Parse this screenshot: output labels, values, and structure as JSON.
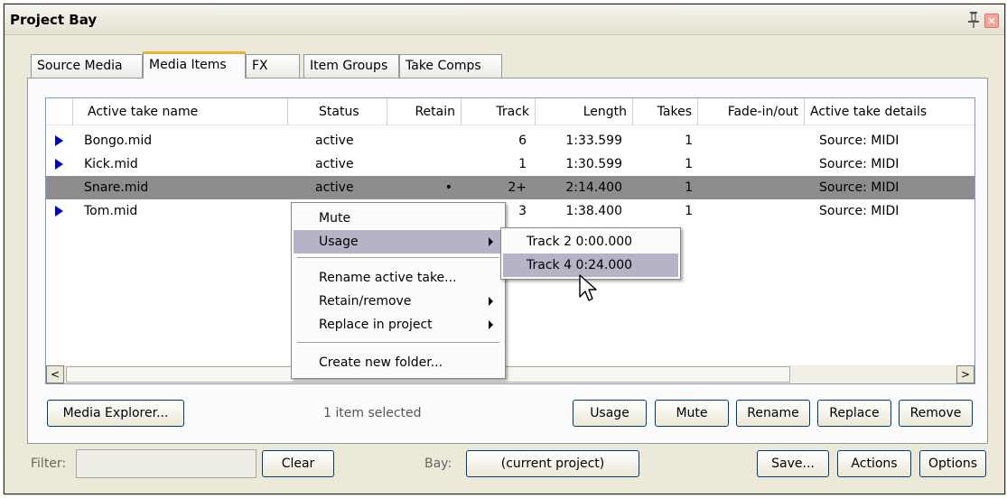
{
  "window": {
    "title": "Project Bay"
  },
  "tabs": [
    "Source Media",
    "Media Items",
    "FX",
    "Item Groups",
    "Take Comps"
  ],
  "table": {
    "columns": [
      "Active take name",
      "Status",
      "Retain",
      "Track",
      "Length",
      "Takes",
      "Fade-in/out",
      "Active take details"
    ],
    "rows": [
      {
        "name": "Bongo.mid",
        "status": "active",
        "retain": "",
        "track": "6",
        "length": "1:33.599",
        "takes": "1",
        "fade": "",
        "details": "Source: MIDI"
      },
      {
        "name": "Kick.mid",
        "status": "active",
        "retain": "",
        "track": "1",
        "length": "1:30.599",
        "takes": "1",
        "fade": "",
        "details": "Source: MIDI"
      },
      {
        "name": "Snare.mid",
        "status": "active",
        "retain": "•",
        "track": "2+",
        "length": "2:14.400",
        "takes": "1",
        "fade": "",
        "details": "Source: MIDI"
      },
      {
        "name": "Tom.mid",
        "status": "",
        "retain": "",
        "track": "3",
        "length": "1:38.400",
        "takes": "1",
        "fade": "",
        "details": "Source: MIDI"
      }
    ]
  },
  "scroll": {
    "left_arrow": "<",
    "right_arrow": ">"
  },
  "buttons": {
    "media_explorer": "Media Explorer...",
    "usage": "Usage",
    "mute": "Mute",
    "rename": "Rename",
    "replace": "Replace",
    "remove": "Remove",
    "clear": "Clear",
    "current_project": "(current project)",
    "save": "Save...",
    "actions": "Actions",
    "options": "Options"
  },
  "status_text": "1 item selected",
  "filter_label": "Filter:",
  "bay_label": "Bay:",
  "context_menu": {
    "items": [
      "Mute",
      "Usage",
      "Rename active take...",
      "Retain/remove",
      "Replace in project",
      "Create new folder..."
    ]
  },
  "usage_submenu": {
    "items": [
      "Track 2  0:00.000",
      "Track 4  0:24.000"
    ]
  },
  "icons": {
    "pin": "pin-icon",
    "close": "close-icon",
    "row_marker": "play-arrow-icon",
    "cursor": "mouse-cursor-icon"
  },
  "colors": {
    "selected_row": "#8d8d8d",
    "menu_highlight": "#b4b4c6",
    "active_tab_accent": "#f0b030",
    "row_arrow": "#0000c8"
  }
}
